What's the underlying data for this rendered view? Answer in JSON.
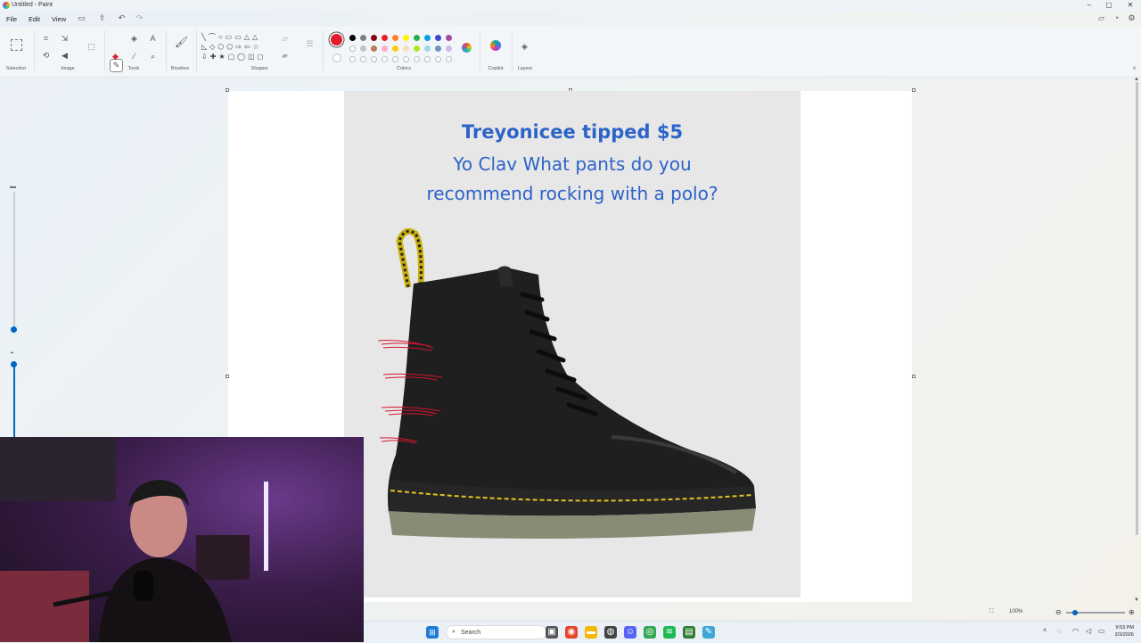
{
  "window": {
    "title": "Untitled - Paint",
    "controls": {
      "minimize": "‒",
      "maximize": "▢",
      "close": "✕"
    }
  },
  "menu": {
    "file": "File",
    "edit": "Edit",
    "view": "View"
  },
  "ribbon": {
    "groups": {
      "selection": "Selection",
      "image": "Image",
      "tools": "Tools",
      "brushes": "Brushes",
      "shapes": "Shapes",
      "colors": "Colors",
      "copilot": "Copilot",
      "layers": "Layers"
    },
    "active_color": "#e41b2c",
    "palette_row1": [
      "#000000",
      "#7f7f7f",
      "#880015",
      "#ed1c24",
      "#ff7f27",
      "#fff200",
      "#22b14c",
      "#00a2e8",
      "#3f48cc",
      "#a349a4"
    ],
    "palette_row2": [
      "#ffffff",
      "#c3c3c3",
      "#b97a57",
      "#ffaec9",
      "#ffc90e",
      "#efe4b0",
      "#b5e61d",
      "#99d9ea",
      "#7092be",
      "#c8bfe7"
    ]
  },
  "canvas": {
    "tip_title": "Treyonicee tipped $5",
    "tip_line1": "Yo Clav What pants do you",
    "tip_line2": "recommend rocking with a polo?"
  },
  "status": {
    "zoom": "100%"
  },
  "taskbar": {
    "search_placeholder": "Search",
    "time": "9:53 PM",
    "date": "2/3/2026"
  }
}
